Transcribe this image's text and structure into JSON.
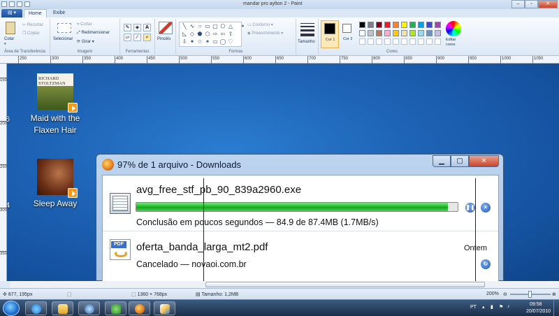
{
  "paint": {
    "window_title": "mandar pro aylton 2 - Paint",
    "tabs": [
      "Home",
      "Exibir"
    ],
    "clipboard": {
      "paste": "Colar",
      "cut": "Recortar",
      "copy": "Copiar",
      "group": "Área de Transferência"
    },
    "image": {
      "select": "Selecionar",
      "crop": "Cortar",
      "resize": "Redimensionar",
      "rotate": "Girar",
      "group": "Imagem"
    },
    "tools_group": "Ferramentas",
    "brushes": "Pincéis",
    "shapes": {
      "outline": "Contorno",
      "fill": "Preenchimento",
      "group": "Formas"
    },
    "size": "Tamanho",
    "color1": "Cor 1",
    "color2": "Cor 2",
    "colors_group": "Cores",
    "edit_colors": "Editar cores",
    "palette": [
      "#000000",
      "#7f7f7f",
      "#880015",
      "#ed1c24",
      "#ff7f27",
      "#fff200",
      "#22b14c",
      "#00a2e8",
      "#3f48cc",
      "#a349a4",
      "#ffffff",
      "#c3c3c3",
      "#b97a57",
      "#ffaec9",
      "#ffc90e",
      "#efe4b0",
      "#b5e61d",
      "#99d9ea",
      "#7092be",
      "#c8bfe7"
    ],
    "ruler_top": [
      "250",
      "300",
      "350",
      "400",
      "450",
      "500",
      "550",
      "600",
      "650",
      "700",
      "750",
      "800",
      "850",
      "900",
      "950",
      "1000",
      "1050"
    ],
    "ruler_left": [
      "150",
      "200",
      "250",
      "300",
      "350"
    ]
  },
  "desktop": {
    "icons": [
      {
        "label_l1": "Maid with the",
        "label_l2": "Flaxen Hair",
        "cover_text": "RICHARD STOLTZMAN"
      },
      {
        "label_l1": "Sleep Away",
        "label_l2": ""
      }
    ],
    "edge_nums": [
      "6",
      "4"
    ]
  },
  "downloads": {
    "title": "97% de 1 arquivo - Downloads",
    "items": [
      {
        "name": "avg_free_stf_pb_90_839a2960.exe",
        "status": "Conclusão em poucos segundos — 84.9 de 87.4MB (1.7MB/s)",
        "progress": 0.97
      },
      {
        "name": "oferta_banda_larga_mt2.pdf",
        "status": "Cancelado — novaoi.com.br",
        "when": "Ontem",
        "icon_text": "PDF"
      }
    ]
  },
  "status": {
    "cursor": "877, 195px",
    "dimensions": "1360 × 768px",
    "size": "Tamanho: 1,2MB",
    "zoom": "200%"
  },
  "taskbar": {
    "lang": "PT",
    "time": "09:58",
    "date": "20/07/2010"
  }
}
